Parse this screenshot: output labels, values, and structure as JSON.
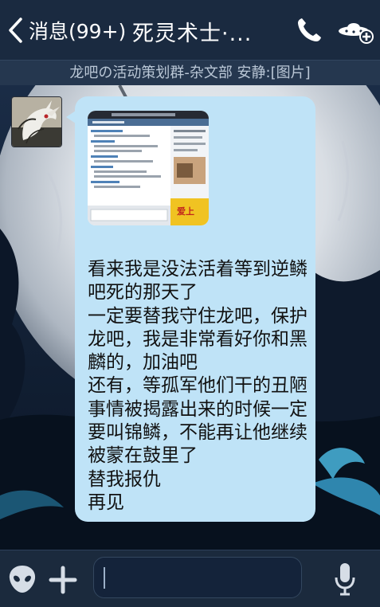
{
  "header": {
    "back_label": "消息(99+)",
    "title": "死灵术士·..."
  },
  "notice": {
    "text": "龙吧の活动策划群-杂文部 安静:[图片]"
  },
  "message": {
    "text": "看来我是没法活着等到逆鳞吧死的那天了\n一定要替我守住龙吧，保护龙吧，我是非常看好你和黑麟的，加油吧\n还有，等孤军他们干的丑陋事情被揭露出来的时候一定要叫锦鳞，不能再让他继续被蒙在鼓里了\n替我报仇\n再见",
    "image_label": "爱上"
  },
  "colors": {
    "header_bg": "#1a2a40",
    "bubble_bg": "#bfe3f7",
    "input_bar_bg": "#1b2a3d"
  },
  "icons": {
    "back": "chevron-left-icon",
    "call": "phone-icon",
    "profile": "alien-ufo-icon",
    "emoji": "alien-face-icon",
    "more": "plus-icon",
    "voice": "microphone-icon"
  }
}
